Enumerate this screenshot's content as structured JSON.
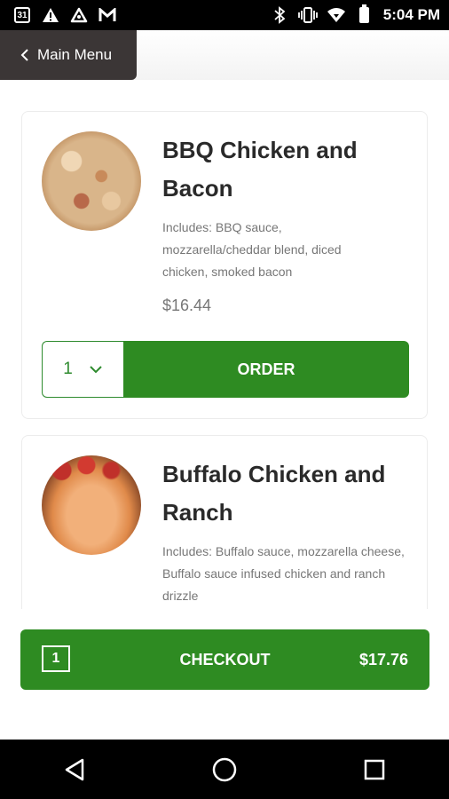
{
  "status_bar": {
    "calendar_day": "31",
    "time": "5:04 PM",
    "icons_left": [
      "calendar-icon",
      "warning-icon",
      "triangle-app-icon",
      "gmail-icon"
    ],
    "icons_right": [
      "bluetooth-icon",
      "vibrate-icon",
      "wifi-icon",
      "battery-icon"
    ]
  },
  "header": {
    "back_label": "Main Menu"
  },
  "menu_items": [
    {
      "title": "BBQ Chicken and Bacon",
      "description": "Includes: BBQ sauce, mozzarella/cheddar blend, diced chicken, smoked bacon",
      "price": "$16.44",
      "quantity": "1",
      "order_label": "ORDER"
    },
    {
      "title": "Buffalo Chicken and Ranch",
      "description": "Includes: Buffalo sauce, mozzarella cheese, Buffalo sauce infused chicken and ranch drizzle"
    }
  ],
  "checkout": {
    "count": "1",
    "label": "CHECKOUT",
    "total": "$17.76"
  },
  "colors": {
    "accent_green": "#2e8b22",
    "back_button_bg": "#3b3636"
  }
}
